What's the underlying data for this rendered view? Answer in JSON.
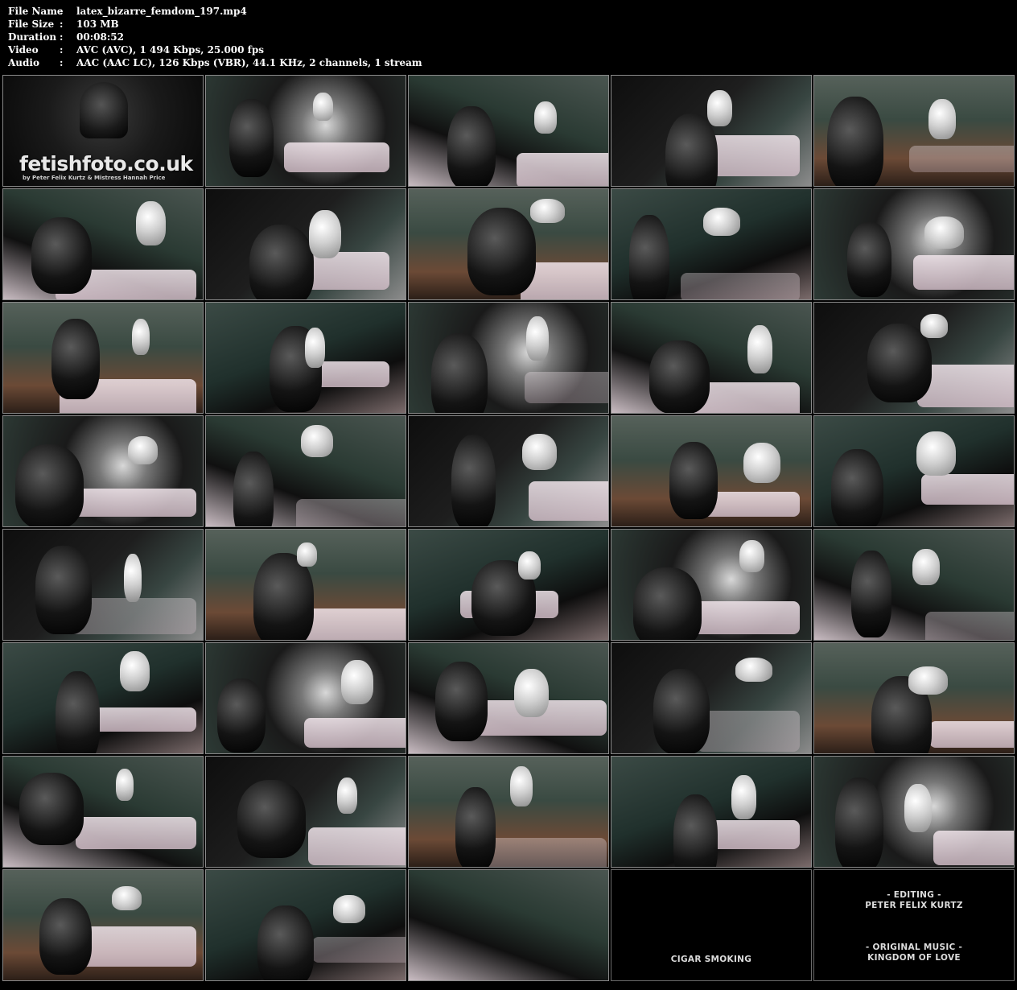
{
  "info": [
    {
      "key": "File Name",
      "sep": ":",
      "value": "latex_bizarre_femdom_197.mp4"
    },
    {
      "key": "File Size",
      "sep": ":",
      "value": "103 MB"
    },
    {
      "key": "Duration",
      "sep": ":",
      "value": "00:08:52"
    },
    {
      "key": "Video",
      "sep": ":",
      "value": "AVC (AVC), 1 494 Kbps, 25.000 fps"
    },
    {
      "key": "Audio",
      "sep": ":",
      "value": "AAC (AAC LC), 126 Kbps (VBR), 44.1 KHz, 2 channels, 1 stream"
    }
  ],
  "logo": {
    "title": "fetishfoto.co.uk",
    "subtitle": "by Peter Felix Kurtz & Mistress Hannah Price"
  },
  "credits": {
    "cigar": "CIGAR SMOKING",
    "editing_label": "- EDITING -",
    "editing_name": "PETER FELIX KURTZ",
    "music_label": "- ORIGINAL MUSIC -",
    "music_name": "KINGDOM OF LOVE"
  },
  "thumbnail_count": 40
}
